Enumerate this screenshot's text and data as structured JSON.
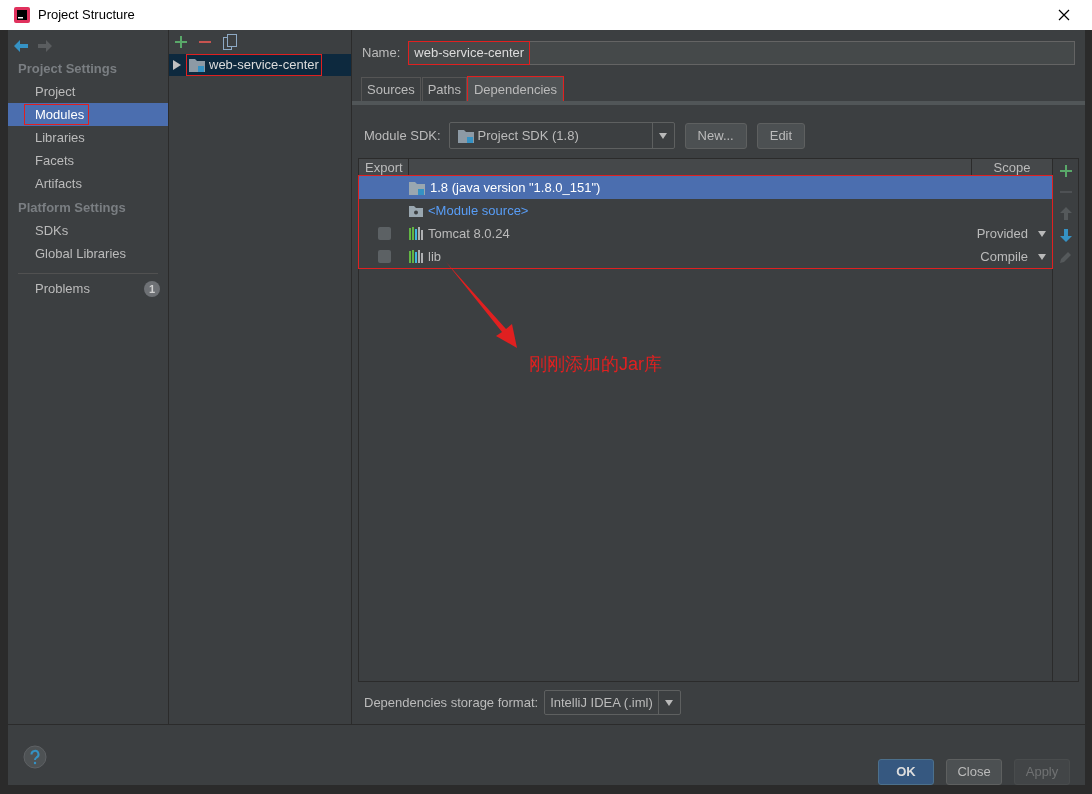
{
  "window": {
    "title": "Project Structure"
  },
  "sidebar": {
    "sections": [
      {
        "heading": "Project Settings",
        "items": [
          {
            "label": "Project",
            "selected": false,
            "highlighted": false
          },
          {
            "label": "Modules",
            "selected": true,
            "highlighted": true
          },
          {
            "label": "Libraries",
            "selected": false,
            "highlighted": false
          },
          {
            "label": "Facets",
            "selected": false,
            "highlighted": false
          },
          {
            "label": "Artifacts",
            "selected": false,
            "highlighted": false
          }
        ]
      },
      {
        "heading": "Platform Settings",
        "items": [
          {
            "label": "SDKs",
            "selected": false,
            "highlighted": false
          },
          {
            "label": "Global Libraries",
            "selected": false,
            "highlighted": false
          }
        ]
      }
    ],
    "problems": {
      "label": "Problems",
      "count": "1"
    }
  },
  "module_tree": {
    "items": [
      {
        "label": "web-service-center",
        "selected": true,
        "expanded": false,
        "highlighted": true
      }
    ]
  },
  "name_field": {
    "label": "Name:",
    "value": "web-service-center",
    "highlighted": true
  },
  "tabs": [
    {
      "label": "Sources",
      "selected": false,
      "highlighted": false
    },
    {
      "label": "Paths",
      "selected": false,
      "highlighted": false
    },
    {
      "label": "Dependencies",
      "selected": true,
      "highlighted": true
    }
  ],
  "module_sdk": {
    "label": "Module SDK:",
    "value": "Project SDK (1.8)",
    "buttons": [
      "New...",
      "Edit"
    ]
  },
  "table": {
    "columns": [
      "Export",
      "Scope"
    ],
    "highlighted": true,
    "rows": [
      {
        "kind": "sdk",
        "label": "1.8 (java version \"1.8.0_151\")",
        "selected": true
      },
      {
        "kind": "source",
        "label": "<Module source>",
        "selected": false
      },
      {
        "kind": "library",
        "label": "Tomcat 8.0.24",
        "scope": "Provided",
        "checked": false,
        "selected": false
      },
      {
        "kind": "library",
        "label": "lib",
        "scope": "Compile",
        "checked": false,
        "selected": false
      }
    ]
  },
  "annotation": {
    "text": "刚刚添加的Jar库"
  },
  "storage_format": {
    "label": "Dependencies storage format:",
    "value": "IntelliJ IDEA (.iml)"
  },
  "footer": {
    "buttons": [
      {
        "label": "OK",
        "kind": "primary",
        "disabled": false
      },
      {
        "label": "Close",
        "kind": "normal",
        "disabled": false
      },
      {
        "label": "Apply",
        "kind": "normal",
        "disabled": true
      }
    ]
  }
}
